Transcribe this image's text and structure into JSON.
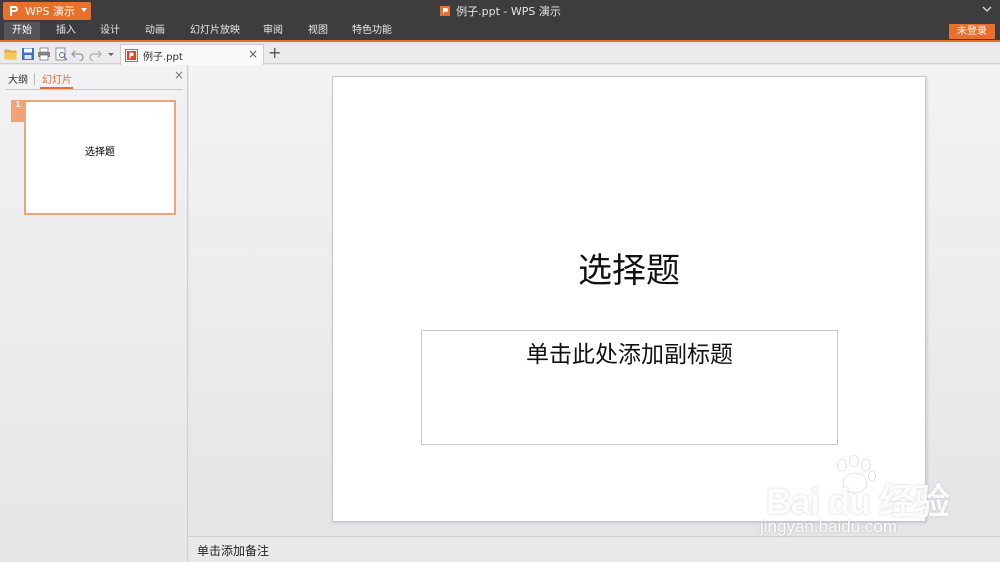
{
  "app": {
    "name": "WPS 演示",
    "window_title": "例子.ppt - WPS 演示"
  },
  "menu": {
    "items": [
      "开始",
      "插入",
      "设计",
      "动画",
      "幻灯片放映",
      "审阅",
      "视图",
      "特色功能"
    ],
    "login_label": "未登录"
  },
  "tabs": {
    "document": "例子.ppt",
    "close_symbol": "×",
    "add_symbol": "+"
  },
  "panel": {
    "tab_outline": "大纲",
    "tab_slides": "幻灯片",
    "close_symbol": "×",
    "thumbnails": [
      {
        "number": "1",
        "title": "选择题"
      }
    ]
  },
  "slide": {
    "title": "选择题",
    "subtitle_placeholder": "单击此处添加副标题"
  },
  "notes": {
    "placeholder": "单击添加备注"
  },
  "watermark": {
    "brand": "Bai du 经验",
    "url": "jingyan.baidu.com"
  },
  "colors": {
    "accent": "#e8702a",
    "titlebar": "#3d3d3f"
  },
  "icons": [
    "wps-logo-icon",
    "open-folder-icon",
    "save-icon",
    "print-icon",
    "print-preview-icon",
    "undo-icon",
    "redo-icon",
    "dropdown-icon",
    "ppt-file-icon",
    "chevron-down-icon"
  ]
}
